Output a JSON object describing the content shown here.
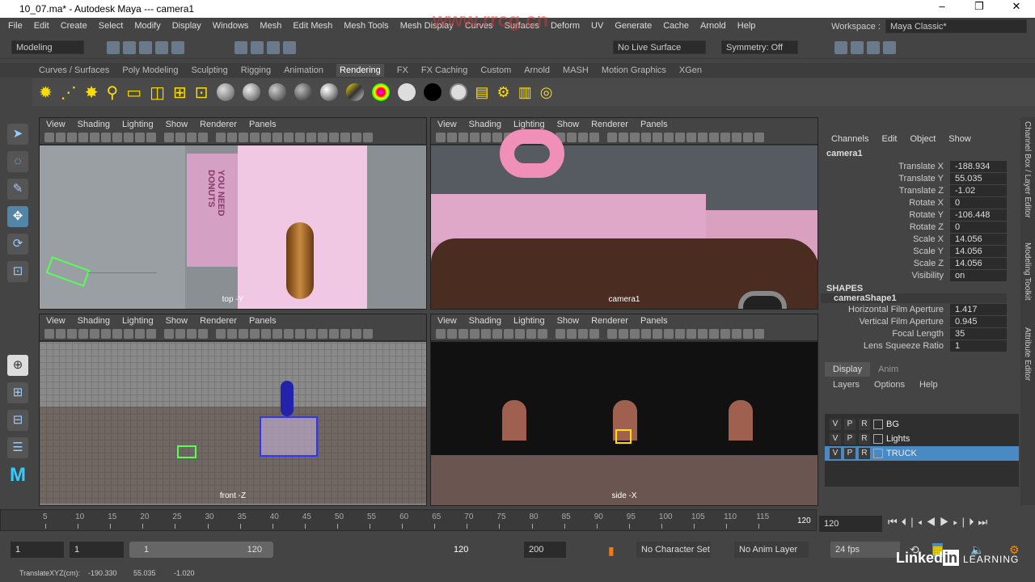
{
  "title": "10_07.ma* - Autodesk Maya  ---  camera1",
  "window_controls": [
    "–",
    "❐",
    "✕"
  ],
  "menus": [
    "File",
    "Edit",
    "Create",
    "Select",
    "Modify",
    "Display",
    "Windows",
    "Mesh",
    "Edit Mesh",
    "Mesh Tools",
    "Mesh Display",
    "Curves",
    "Surfaces",
    "Deform",
    "UV",
    "Generate",
    "Cache",
    "Arnold",
    "Help"
  ],
  "workspace": {
    "label": "Workspace :",
    "value": "Maya Classic*"
  },
  "status": {
    "mode": "Modeling",
    "live_surface": "No Live Surface",
    "symmetry": "Symmetry: Off"
  },
  "shelf_tabs": [
    "Curves / Surfaces",
    "Poly Modeling",
    "Sculpting",
    "Rigging",
    "Animation",
    "Rendering",
    "FX",
    "FX Caching",
    "Custom",
    "Arnold",
    "MASH",
    "Motion Graphics",
    "XGen"
  ],
  "active_shelf": "Rendering",
  "panel_menu": [
    "View",
    "Shading",
    "Lighting",
    "Show",
    "Renderer",
    "Panels"
  ],
  "viewports": [
    {
      "label": "top -Y",
      "box_text": "YOU NEED DONUTS"
    },
    {
      "label": "camera1"
    },
    {
      "label": "front -Z"
    },
    {
      "label": "side -X"
    }
  ],
  "channel_box": {
    "menu": [
      "Channels",
      "Edit",
      "Object",
      "Show"
    ],
    "object": "camera1",
    "attrs": [
      [
        "Translate X",
        "-188.934"
      ],
      [
        "Translate Y",
        "55.035"
      ],
      [
        "Translate Z",
        "-1.02"
      ],
      [
        "Rotate X",
        "0"
      ],
      [
        "Rotate Y",
        "-106.448"
      ],
      [
        "Rotate Z",
        "0"
      ],
      [
        "Scale X",
        "14.056"
      ],
      [
        "Scale Y",
        "14.056"
      ],
      [
        "Scale Z",
        "14.056"
      ],
      [
        "Visibility",
        "on"
      ]
    ],
    "shapes_header": "SHAPES",
    "shape": "cameraShape1",
    "shape_attrs": [
      [
        "Horizontal Film Aperture",
        "1.417"
      ],
      [
        "Vertical Film Aperture",
        "0.945"
      ],
      [
        "Focal Length",
        "35"
      ],
      [
        "Lens Squeeze Ratio",
        "1"
      ]
    ]
  },
  "side_tabs": [
    "Channel Box / Layer Editor",
    "Modeling Toolkit",
    "Attribute Editor"
  ],
  "layer_editor": {
    "tabs": [
      "Display",
      "Anim"
    ],
    "menu": [
      "Layers",
      "Options",
      "Help"
    ],
    "layers": [
      {
        "name": "BG",
        "selected": false
      },
      {
        "name": "Lights",
        "selected": false
      },
      {
        "name": "TRUCK",
        "selected": true
      }
    ],
    "flags": [
      "V",
      "P",
      "R"
    ]
  },
  "timeline": {
    "ticks": [
      5,
      10,
      15,
      20,
      25,
      30,
      35,
      40,
      45,
      50,
      55,
      60,
      65,
      70,
      75,
      80,
      85,
      90,
      95,
      100,
      105,
      110,
      115,
      120
    ],
    "current": "120",
    "current_field": "120"
  },
  "range": {
    "start": "1",
    "anim_start": "1",
    "range_start": "1",
    "range_end": "120",
    "anim_end": "120",
    "end": "200",
    "character_set": "No Character Set",
    "anim_layer": "No Anim Layer",
    "fps": "24 fps"
  },
  "help_line": {
    "label": "TranslateXYZ(cm):",
    "x": "-190.330",
    "y": "55.035",
    "z": "-1.020"
  },
  "watermark": {
    "site": "www.rrcg.cn",
    "brand": "LinkedIn LEARNING"
  },
  "colors": {
    "selection": "#4a8ac4",
    "accent": "#5285a6"
  }
}
